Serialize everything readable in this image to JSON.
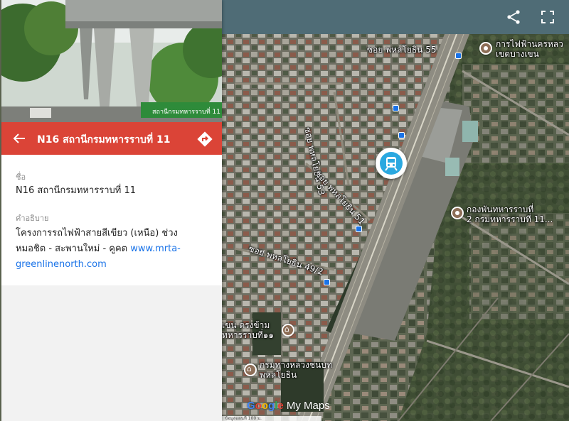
{
  "panel": {
    "title": "N16 สถานีกรมทหารราบที่ 11",
    "photo_sign": "สถานีกรมทหารราบที่ 11",
    "name_label": "ชื่อ",
    "name_value": "N16 สถานีกรมทหารราบที่ 11",
    "desc_label": "คำอธิบาย",
    "desc_text": "โครงการรถไฟฟ้าสายสีเขียว (เหนือ) ช่วงหมอชิต - สะพานใหม่ - คูคต ",
    "desc_link": "www.mrta-greenlinenorth.com"
  },
  "map": {
    "labels": {
      "soi55": "ซอย พหลโยธิน 55",
      "soi53": "ซอย พหลโยธิน 53",
      "soi51": "ซอย พหลโยธิน 51",
      "soi49": "ซอย พหลโยธิน 49/2",
      "poi_top_line1": "การไฟฟ้านครหลว",
      "poi_top_line2": "เขตบางเขน",
      "poi_mid_line1": "กองพันทหารราบที่",
      "poi_mid_line2": "2 กรมทหารราบที่ 11...",
      "poi_bottom1_line1": "เขน ตรงข้าม",
      "poi_bottom1_line2": "ทหารราบที่๑๑",
      "poi_bottom2_line1": "กรมทางหลวงชนบท",
      "poi_bottom2_line2": "พหลโยธิน"
    },
    "footer_text": "ข้อมูลแผนที่   100 ม."
  },
  "branding": {
    "logo_letters": [
      "G",
      "o",
      "o",
      "g",
      "l",
      "e"
    ],
    "mymaps": "My Maps"
  },
  "colors": {
    "header": "#db4437",
    "topbar": "#4f6c76",
    "transit": "#2aa8e0",
    "link": "#1a73e8"
  },
  "icons": {
    "back": "arrow-back-icon",
    "directions": "directions-icon",
    "share": "share-icon",
    "fullscreen": "fullscreen-icon",
    "station": "train-icon"
  }
}
